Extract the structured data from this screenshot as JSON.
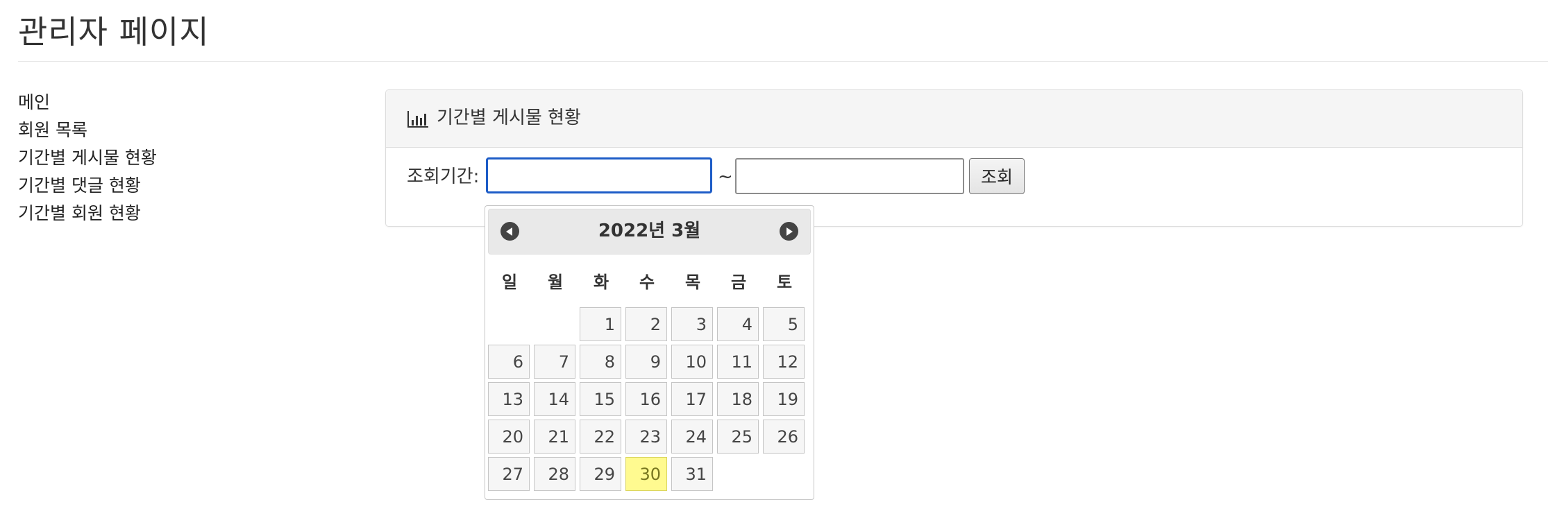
{
  "header": {
    "title": "관리자 페이지"
  },
  "sidebar": {
    "items": [
      {
        "label": "메인"
      },
      {
        "label": "회원 목록"
      },
      {
        "label": "기간별 게시물 현황"
      },
      {
        "label": "기간별 댓글 현황"
      },
      {
        "label": "기간별 회원 현황"
      }
    ]
  },
  "panel": {
    "icon": "bar-chart-icon",
    "title": "기간별 게시물 현황",
    "period_label": "조회기간:",
    "start_value": "",
    "end_value": "",
    "separator": "~",
    "search_label": "조회"
  },
  "datepicker": {
    "title": "2022년 3월",
    "weekdays": [
      "일",
      "월",
      "화",
      "수",
      "목",
      "금",
      "토"
    ],
    "first_weekday_index": 2,
    "days": [
      "1",
      "2",
      "3",
      "4",
      "5",
      "6",
      "7",
      "8",
      "9",
      "10",
      "11",
      "12",
      "13",
      "14",
      "15",
      "16",
      "17",
      "18",
      "19",
      "20",
      "21",
      "22",
      "23",
      "24",
      "25",
      "26",
      "27",
      "28",
      "29",
      "30",
      "31"
    ],
    "today": "30",
    "colors": {
      "today_bg": "#fffa90",
      "focus_border": "#1d5cc7"
    }
  }
}
